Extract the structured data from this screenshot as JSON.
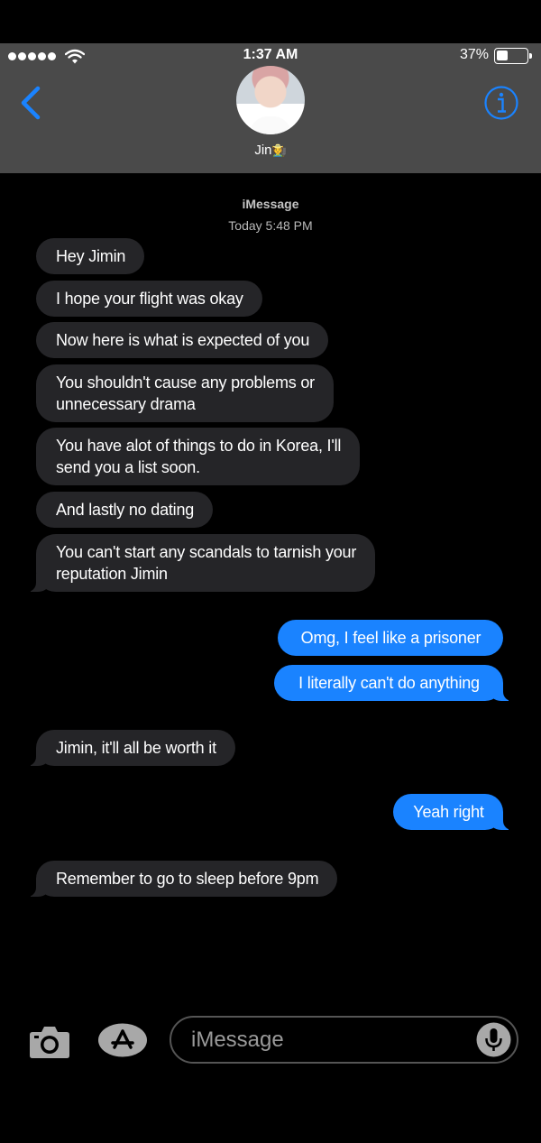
{
  "status_bar": {
    "time": "1:37 AM",
    "battery_percent": "37%",
    "battery_level": 0.37,
    "signal_bars": 5
  },
  "header": {
    "contact_name": "Jin",
    "contact_emoji": "🧑‍🌾",
    "back_icon": "chevron-left-icon",
    "info_icon": "info-icon"
  },
  "thread": {
    "service_label": "iMessage",
    "timestamp": "Today 5:48 PM",
    "messages": [
      {
        "direction": "received",
        "text": "Hey Jimin"
      },
      {
        "direction": "received",
        "text": "I hope your flight was okay"
      },
      {
        "direction": "received",
        "text": "Now here is what is expected of you"
      },
      {
        "direction": "received",
        "lines": [
          "You shouldn't cause any problems or",
          "unnecessary drama"
        ]
      },
      {
        "direction": "received",
        "lines": [
          "You have alot of things to do in Korea, I'll",
          "send you a list soon."
        ]
      },
      {
        "direction": "received",
        "text": "And lastly no dating"
      },
      {
        "direction": "received",
        "lines": [
          "You can't start any scandals to tarnish your",
          "reputation Jimin"
        ]
      },
      {
        "direction": "sent",
        "text": "Omg, I feel like a prisoner"
      },
      {
        "direction": "sent",
        "text": "I literally can't do anything"
      },
      {
        "direction": "received",
        "text": "Jimin, it'll all be worth it"
      },
      {
        "direction": "sent",
        "text": "Yeah right"
      },
      {
        "direction": "received",
        "text": "Remember to go to sleep before 9pm"
      }
    ]
  },
  "input_bar": {
    "placeholder": "iMessage",
    "value": "",
    "icons": [
      "camera-icon",
      "app-store-icon",
      "microphone-icon"
    ]
  },
  "colors": {
    "header_bg": "#4a4a4a",
    "accent_blue": "#1a83ff",
    "received_bubble": "#252528",
    "background": "#000000"
  }
}
